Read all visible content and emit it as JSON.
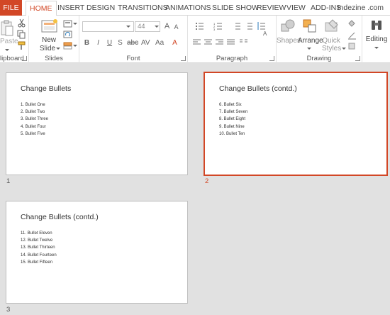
{
  "tabs": {
    "file": "FILE",
    "home": "HOME",
    "insert": "INSERT",
    "design": "DESIGN",
    "transitions": "TRANSITIONS",
    "animations": "ANIMATIONS",
    "slideshow": "SLIDE SHOW",
    "review": "REVIEW",
    "view": "VIEW",
    "addins": "ADD-INS"
  },
  "account": "Indezine .com",
  "ribbon": {
    "clipboard": {
      "label": "lipboard",
      "paste_label": "Paste"
    },
    "slides": {
      "label": "Slides",
      "new_label": "New",
      "slide_label": "Slide"
    },
    "font": {
      "label": "Font",
      "size_value": "44"
    },
    "paragraph": {
      "label": "Paragraph"
    },
    "drawing": {
      "label": "Drawing",
      "shapes_label": "Shapes",
      "arrange_label": "Arrange",
      "quick_label": "Quick",
      "styles_label": "Styles"
    },
    "editing": {
      "label": "Editing"
    }
  },
  "slides": [
    {
      "number": "1",
      "title": "Change Bullets",
      "bullets": [
        "1.  Bullet One",
        "2.  Bullet Two",
        "3.  Bullet Three",
        "4.  Bullet Four",
        "5.  Bullet Five"
      ]
    },
    {
      "number": "2",
      "title": "Change Bullets (contd.)",
      "bullets": [
        "6.  Bullet Six",
        "7.  Bullet Seven",
        "8.  Bullet Eight",
        "9.  Bullet Nine",
        "10. Bullet Ten"
      ]
    },
    {
      "number": "3",
      "title": "Change Bullets (contd.)",
      "bullets": [
        "11. Bullet Eleven",
        "12. Bullet Twelve",
        "13. Bullet Thirteen",
        "14. Bullet Fourteen",
        "15. Bullet Fifteen"
      ]
    }
  ],
  "colors": {
    "accent": "#d24726",
    "background": "#e1e1e1"
  }
}
